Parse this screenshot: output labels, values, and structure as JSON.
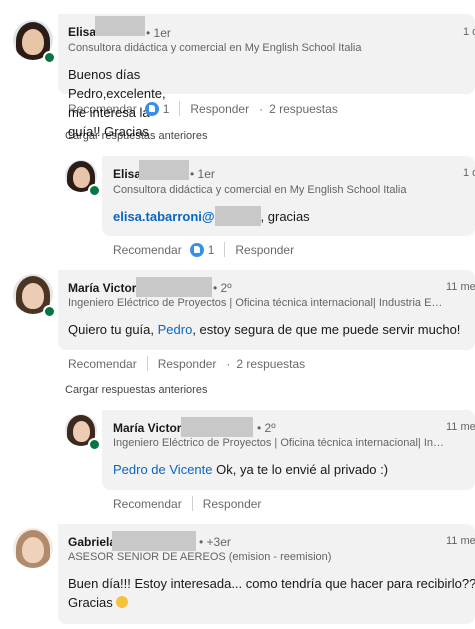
{
  "comments": [
    {
      "name": "Elisa",
      "degree": "• 1er",
      "time": "1 d",
      "headline": "Consultora didáctica y comercial en My English School Italia",
      "body": "Buenos días Pedro,excelente, me interesa la guía!! Gracias",
      "actions": {
        "like": "Recomendar",
        "reaction_count": "1",
        "reply": "Responder",
        "replies": "2 respuestas"
      }
    },
    {
      "name": "Elisa",
      "degree": "• 1er",
      "time": "1 d",
      "headline": "Consultora didáctica y comercial en My English School Italia",
      "body_mention": "elisa.tabarroni@",
      "body": ", gracias",
      "actions": {
        "like": "Recomendar",
        "reaction_count": "1",
        "reply": "Responder"
      }
    },
    {
      "name": "María Victoria",
      "degree": "• 2º",
      "time": "11 me",
      "headline": "Ingeniero Eléctrico de Proyectos | Oficina técnica internacional| Industria E…",
      "body_prefix": "Quiero tu guía, ",
      "body_mention": "Pedro",
      "body": ", estoy segura de que me puede servir mucho!",
      "actions": {
        "like": "Recomendar",
        "reply": "Responder",
        "replies": "2 respuestas"
      }
    },
    {
      "name": "María Victoria",
      "degree": "• 2º",
      "time": "11 me",
      "headline": "Ingeniero Eléctrico de Proyectos | Oficina técnica internacional| In…",
      "body_mention": "Pedro de Vicente",
      "body": " Ok, ya te lo envié al privado :)",
      "actions": {
        "like": "Recomendar",
        "reply": "Responder"
      }
    },
    {
      "name": "Gabriela",
      "degree": "• +3er",
      "time": "11 me",
      "headline": "ASESOR SENIOR DE AEREOS (emision - reemision)",
      "body_line1": "Buen día!!! Estoy interesada... como tendría que hacer para recibirlo??",
      "body_line2": "Gracias"
    }
  ],
  "load_more": [
    "Cargar respuestas anteriores",
    "Cargar respuestas anteriores"
  ],
  "colors": {
    "bubble": "#f2f2f2",
    "link": "#0a66c2",
    "online": "#057642",
    "redaction": "#c8c8c8"
  },
  "icons": {
    "reaction": "like-reaction-icon",
    "presence": "online-status-icon",
    "emoji": "smiling-face-emoji"
  }
}
